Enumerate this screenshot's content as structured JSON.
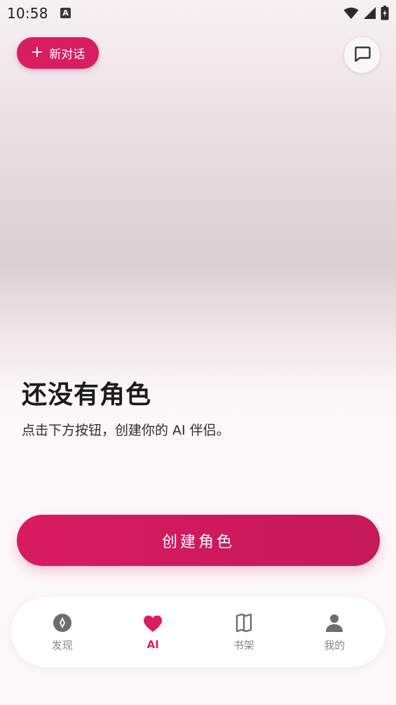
{
  "status_bar": {
    "time": "10:58",
    "notification_icon": "a-letter-icon",
    "icons": [
      "wifi-icon",
      "signal-icon",
      "battery-icon"
    ]
  },
  "header": {
    "new_chat_label": "新对话",
    "new_chat_icon": "plus-icon",
    "messages_icon": "chat-bubble-icon"
  },
  "empty_state": {
    "title": "还没有角色",
    "description": "点击下方按钮，创建你的 AI 伴侣。"
  },
  "create_button_label": "创建角色",
  "bottom_nav": {
    "items": [
      {
        "label": "发现",
        "icon": "compass-icon",
        "active": false
      },
      {
        "label": "AI",
        "icon": "heart-icon",
        "active": true
      },
      {
        "label": "书架",
        "icon": "book-icon",
        "active": false
      },
      {
        "label": "我的",
        "icon": "person-icon",
        "active": false
      }
    ]
  },
  "colors": {
    "accent": "#d81e60",
    "inactive": "#8a8788",
    "icon_gray": "#6f6c6d"
  }
}
